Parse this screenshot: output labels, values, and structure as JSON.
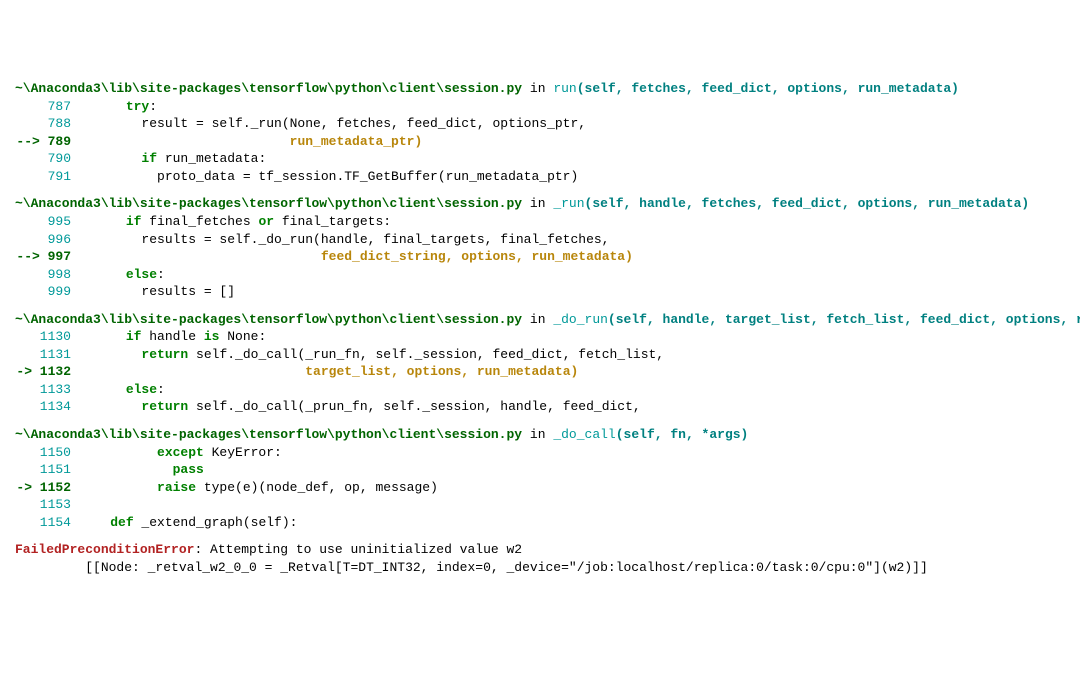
{
  "frames": [
    {
      "path": "~\\Anaconda3\\lib\\site-packages\\tensorflow\\python\\client\\session.py",
      "in": " in ",
      "fn": "run",
      "args": "(self, fetches, feed_dict, options, run_metadata)",
      "lines": [
        {
          "n": "787",
          "cur": false,
          "seg": [
            {
              "c": "",
              "t": "      "
            },
            {
              "c": "kw",
              "t": "try"
            },
            {
              "c": "",
              "t": ":"
            }
          ]
        },
        {
          "n": "788",
          "cur": false,
          "seg": [
            {
              "c": "",
              "t": "        result = self._run(None, fetches, feed_dict, options_ptr,"
            }
          ]
        },
        {
          "n": "--> 789",
          "cur": true,
          "seg": [
            {
              "c": "",
              "t": "                           "
            },
            {
              "c": "cont",
              "t": "run_metadata_ptr)"
            }
          ]
        },
        {
          "n": "790",
          "cur": false,
          "seg": [
            {
              "c": "",
              "t": "        "
            },
            {
              "c": "kw",
              "t": "if"
            },
            {
              "c": "",
              "t": " run_metadata:"
            }
          ]
        },
        {
          "n": "791",
          "cur": false,
          "seg": [
            {
              "c": "",
              "t": "          proto_data = tf_session.TF_GetBuffer(run_metadata_ptr)"
            }
          ]
        }
      ]
    },
    {
      "path": "~\\Anaconda3\\lib\\site-packages\\tensorflow\\python\\client\\session.py",
      "in": " in ",
      "fn": "_run",
      "args": "(self, handle, fetches, feed_dict, options, run_metadata)",
      "lines": [
        {
          "n": "995",
          "cur": false,
          "seg": [
            {
              "c": "",
              "t": "      "
            },
            {
              "c": "kw",
              "t": "if"
            },
            {
              "c": "",
              "t": " final_fetches "
            },
            {
              "c": "kw",
              "t": "or"
            },
            {
              "c": "",
              "t": " final_targets:"
            }
          ]
        },
        {
          "n": "996",
          "cur": false,
          "seg": [
            {
              "c": "",
              "t": "        results = self._do_run(handle, final_targets, final_fetches,"
            }
          ]
        },
        {
          "n": "--> 997",
          "cur": true,
          "seg": [
            {
              "c": "",
              "t": "                               "
            },
            {
              "c": "cont",
              "t": "feed_dict_string, options, run_metadata)"
            }
          ]
        },
        {
          "n": "998",
          "cur": false,
          "seg": [
            {
              "c": "",
              "t": "      "
            },
            {
              "c": "kw",
              "t": "else"
            },
            {
              "c": "",
              "t": ":"
            }
          ]
        },
        {
          "n": "999",
          "cur": false,
          "seg": [
            {
              "c": "",
              "t": "        results = []"
            }
          ]
        }
      ]
    },
    {
      "path": "~\\Anaconda3\\lib\\site-packages\\tensorflow\\python\\client\\session.py",
      "in": " in ",
      "fn": "_do_run",
      "args": "(self, handle, target_list, fetch_list, feed_dict, options, run_metadata)",
      "lines": [
        {
          "n": "1130",
          "cur": false,
          "seg": [
            {
              "c": "",
              "t": "      "
            },
            {
              "c": "kw",
              "t": "if"
            },
            {
              "c": "",
              "t": " handle "
            },
            {
              "c": "kw",
              "t": "is"
            },
            {
              "c": "",
              "t": " None:"
            }
          ]
        },
        {
          "n": "1131",
          "cur": false,
          "seg": [
            {
              "c": "",
              "t": "        "
            },
            {
              "c": "kw",
              "t": "return"
            },
            {
              "c": "",
              "t": " self._do_call(_run_fn, self._session, feed_dict, fetch_list,"
            }
          ]
        },
        {
          "n": "-> 1132",
          "cur": true,
          "seg": [
            {
              "c": "",
              "t": "                             "
            },
            {
              "c": "cont",
              "t": "target_list, options, run_metadata)"
            }
          ]
        },
        {
          "n": "1133",
          "cur": false,
          "seg": [
            {
              "c": "",
              "t": "      "
            },
            {
              "c": "kw",
              "t": "else"
            },
            {
              "c": "",
              "t": ":"
            }
          ]
        },
        {
          "n": "1134",
          "cur": false,
          "seg": [
            {
              "c": "",
              "t": "        "
            },
            {
              "c": "kw",
              "t": "return"
            },
            {
              "c": "",
              "t": " self._do_call(_prun_fn, self._session, handle, feed_dict,"
            }
          ]
        }
      ]
    },
    {
      "path": "~\\Anaconda3\\lib\\site-packages\\tensorflow\\python\\client\\session.py",
      "in": " in ",
      "fn": "_do_call",
      "args": "(self, fn, *args)",
      "lines": [
        {
          "n": "1150",
          "cur": false,
          "seg": [
            {
              "c": "",
              "t": "          "
            },
            {
              "c": "kw",
              "t": "except"
            },
            {
              "c": "",
              "t": " KeyError:"
            }
          ]
        },
        {
          "n": "1151",
          "cur": false,
          "seg": [
            {
              "c": "",
              "t": "            "
            },
            {
              "c": "kw",
              "t": "pass"
            }
          ]
        },
        {
          "n": "-> 1152",
          "cur": true,
          "seg": [
            {
              "c": "",
              "t": "          "
            },
            {
              "c": "kw",
              "t": "raise"
            },
            {
              "c": "",
              "t": " type(e)(node_def, op, message)"
            }
          ]
        },
        {
          "n": "1153",
          "cur": false,
          "seg": [
            {
              "c": "",
              "t": ""
            }
          ]
        },
        {
          "n": "1154",
          "cur": false,
          "seg": [
            {
              "c": "",
              "t": "    "
            },
            {
              "c": "kw",
              "t": "def"
            },
            {
              "c": "",
              "t": " _extend_graph(self):"
            }
          ]
        }
      ]
    }
  ],
  "error": {
    "name": "FailedPreconditionError",
    "msg": ": Attempting to use uninitialized value w2",
    "detail": "\t [[Node: _retval_w2_0_0 = _Retval[T=DT_INT32, index=0, _device=\"/job:localhost/replica:0/task:0/cpu:0\"](w2)]]"
  }
}
